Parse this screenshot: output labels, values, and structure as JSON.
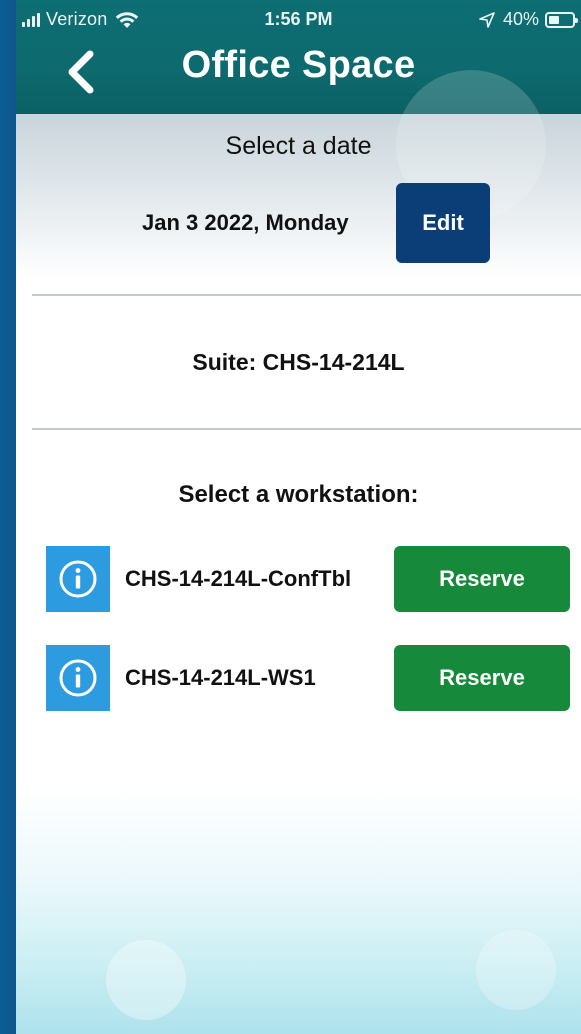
{
  "status_bar": {
    "carrier": "Verizon",
    "time": "1:56 PM",
    "battery_percent": "40%",
    "battery_level": 0.4
  },
  "header": {
    "title": "Office Space"
  },
  "date_section": {
    "label": "Select a date",
    "date": "Jan 3 2022, Monday",
    "edit_label": "Edit"
  },
  "suite": {
    "text": "Suite: CHS-14-214L"
  },
  "workstations": {
    "label": "Select a workstation:",
    "items": [
      {
        "name": "CHS-14-214L-ConfTbl",
        "action_label": "Reserve"
      },
      {
        "name": "CHS-14-214L-WS1",
        "action_label": "Reserve"
      }
    ]
  },
  "colors": {
    "header": "#0d6a6e",
    "edit_button": "#0b3e76",
    "reserve_button": "#168a3a",
    "info_icon": "#2d9be0"
  }
}
